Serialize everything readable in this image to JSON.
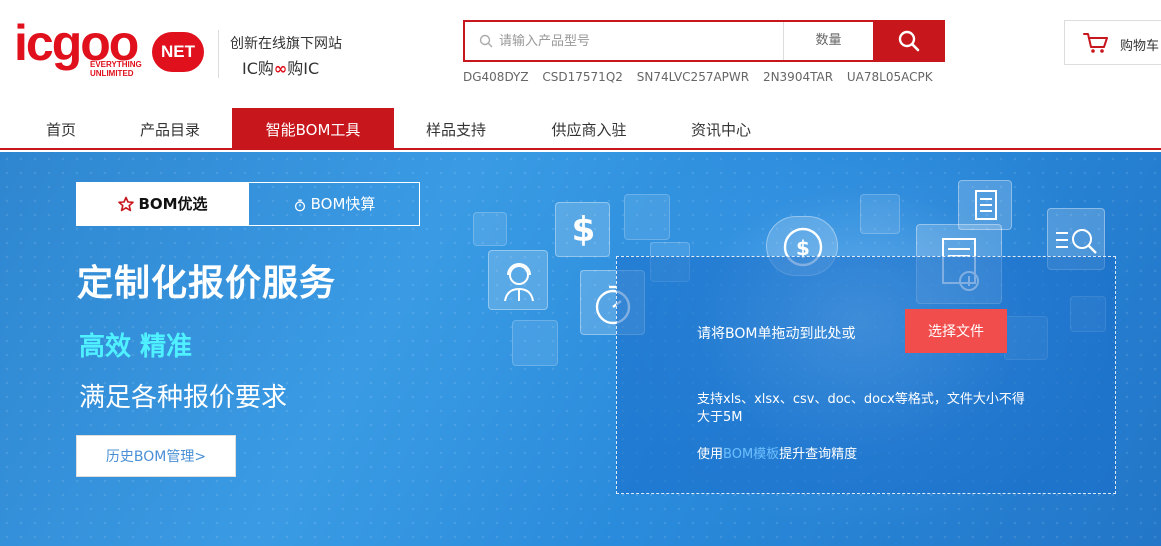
{
  "header": {
    "logo_text": "icgoo",
    "logo_badge": "NET",
    "logo_tagline": "EVERYTHING UNLIMITED",
    "slogan_line1": "创新在线旗下网站",
    "slogan_prefix": "IC购",
    "slogan_symbol": "∞",
    "slogan_suffix": "购IC",
    "search": {
      "placeholder": "请输入产品型号",
      "qty_label": "数量"
    },
    "hot_keys": [
      "DG408DYZ",
      "CSD17571Q2",
      "SN74LVC257APWR",
      "2N3904TAR",
      "UA78L05ACPK"
    ],
    "cart_label": "购物车"
  },
  "nav": {
    "items": [
      {
        "label": "首页"
      },
      {
        "label": "产品目录"
      },
      {
        "label": "智能BOM工具"
      },
      {
        "label": "样品支持"
      },
      {
        "label": "供应商入驻"
      },
      {
        "label": "资讯中心"
      }
    ],
    "active_index": 2
  },
  "banner": {
    "tabs": [
      {
        "label": "BOM优选"
      },
      {
        "label": "BOM快算"
      }
    ],
    "headline": "定制化报价服务",
    "subline": "高效 精准",
    "description": "满足各种报价要求",
    "history_button": "历史BOM管理>",
    "upload": {
      "drop_text": "请将BOM单拖动到此处或",
      "choose_button": "选择文件",
      "format_note": "支持xls、xlsx、csv、doc、docx等格式，文件大小不得大于5M",
      "template_prefix": "使用",
      "template_link": "BOM模板",
      "template_suffix": "提升查询精度"
    }
  },
  "colors": {
    "brand_red": "#c8161d",
    "button_red": "#f14d4d",
    "accent_cyan": "#4ff0ff",
    "link_blue": "#6dbfff"
  }
}
